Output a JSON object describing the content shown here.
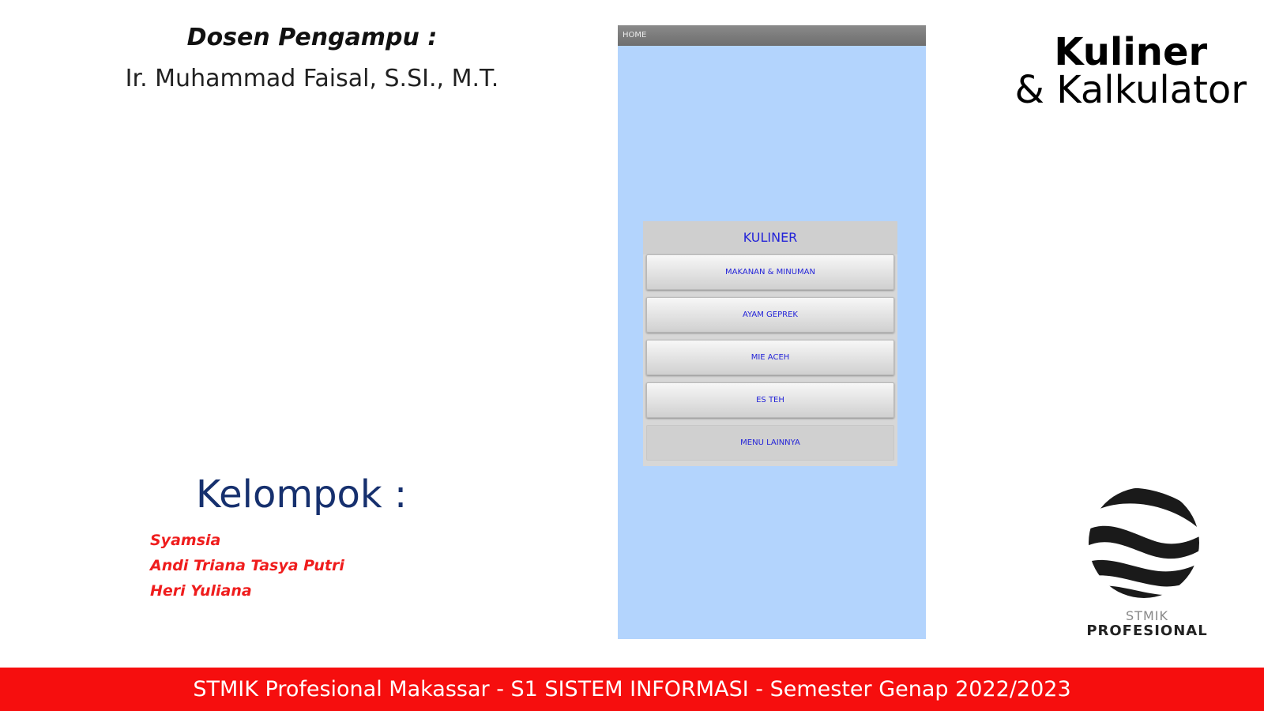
{
  "dosen": {
    "title": "Dosen Pengampu :",
    "name": "Ir. Muhammad Faisal, S.SI., M.T."
  },
  "app_title": {
    "line1": "Kuliner",
    "line2": "& Kalkulator"
  },
  "kelompok": {
    "title": "Kelompok :",
    "members": [
      "Syamsia",
      "Andi Triana Tasya Putri",
      "Heri Yuliana"
    ]
  },
  "phone": {
    "bar_label": "HOME",
    "menu_title": "KULINER",
    "buttons": [
      "MAKANAN & MINUMAN",
      "AYAM GEPREK",
      "MIE ACEH",
      "ES TEH",
      "MENU LAINNYA"
    ]
  },
  "logo": {
    "line1": "STMIK",
    "line2": "PROFESIONAL"
  },
  "footer": {
    "text": "STMIK Profesional Makassar - S1 SISTEM INFORMASI - Semester Genap 2022/2023"
  },
  "colors": {
    "footer_bg": "#f60e0e",
    "phone_bg": "#b3d4fd",
    "button_text": "#2424d8",
    "member_text": "#ef1d1d",
    "kelompok_text": "#16306e"
  }
}
